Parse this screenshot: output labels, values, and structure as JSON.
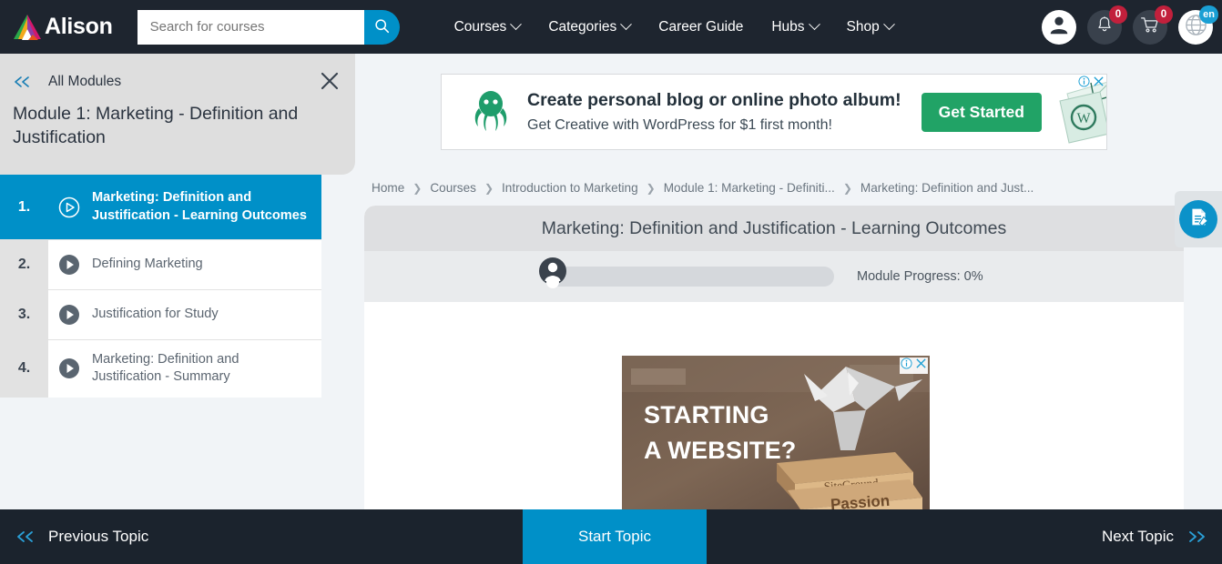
{
  "header": {
    "brand": "Alison",
    "search": {
      "value": "",
      "placeholder": "Search for courses",
      "icon": "search-icon"
    },
    "nav": [
      {
        "label": "Courses",
        "caret": true
      },
      {
        "label": "Categories",
        "caret": true
      },
      {
        "label": "Career Guide",
        "caret": false
      },
      {
        "label": "Hubs",
        "caret": true
      },
      {
        "label": "Shop",
        "caret": true
      }
    ],
    "actions": {
      "avatar_icon": "user-avatar-icon",
      "notifications": {
        "icon": "bell-icon",
        "count": "0"
      },
      "cart": {
        "icon": "cart-icon",
        "count": "0"
      },
      "language": {
        "icon": "globe-icon",
        "code": "en"
      }
    },
    "accent": "#0090c8",
    "background": "#1e252f"
  },
  "sidebar": {
    "back_label": "All Modules",
    "back_icon": "double-chevron-left-icon",
    "close_icon": "close-icon",
    "module_title": "Module 1: Marketing - Definition and Justification",
    "lessons": [
      {
        "number": "1.",
        "title": "Marketing: Definition and Justification - Learning Outcomes",
        "icon": "play-circle-icon",
        "active": true
      },
      {
        "number": "2.",
        "title": "Defining Marketing",
        "icon": "play-circle-icon",
        "active": false
      },
      {
        "number": "3.",
        "title": "Justification for Study",
        "icon": "play-circle-icon",
        "active": false
      },
      {
        "number": "4.",
        "title": "Marketing: Definition and Justification - Summary",
        "icon": "play-circle-icon",
        "active": false
      }
    ]
  },
  "ad_top": {
    "headline": "Create personal blog or online photo album!",
    "subtext": "Get Creative with WordPress for $1 first month!",
    "cta": "Get Started",
    "logo_icon": "octopus-icon",
    "art_icon": "wordpress-envelope-icon",
    "info_icon": "ad-info-icon",
    "close_icon": "ad-close-icon",
    "cta_color": "#21a366"
  },
  "breadcrumb": [
    "Home",
    "Courses",
    "Introduction to Marketing",
    "Module 1: Marketing - Definiti...",
    "Marketing: Definition and Just..."
  ],
  "content": {
    "title": "Marketing: Definition and Justification - Learning Outcomes",
    "progress": {
      "label": "Module Progress: 0%",
      "percent": 0,
      "avatar_icon": "user-avatar-icon"
    }
  },
  "ad_bottom": {
    "line1": "STARTING",
    "line2": "A WEBSITE?",
    "brand": "SiteGround",
    "block_word": "Passion",
    "info_icon": "ad-info-icon",
    "close_icon": "ad-close-icon"
  },
  "side_tab": {
    "icon": "note-edit-icon"
  },
  "bottom_bar": {
    "previous": {
      "label": "Previous Topic",
      "icon": "double-chevron-left-icon"
    },
    "start": {
      "label": "Start Topic",
      "color": "#0090c8"
    },
    "next": {
      "label": "Next Topic",
      "icon": "double-chevron-right-icon"
    }
  }
}
